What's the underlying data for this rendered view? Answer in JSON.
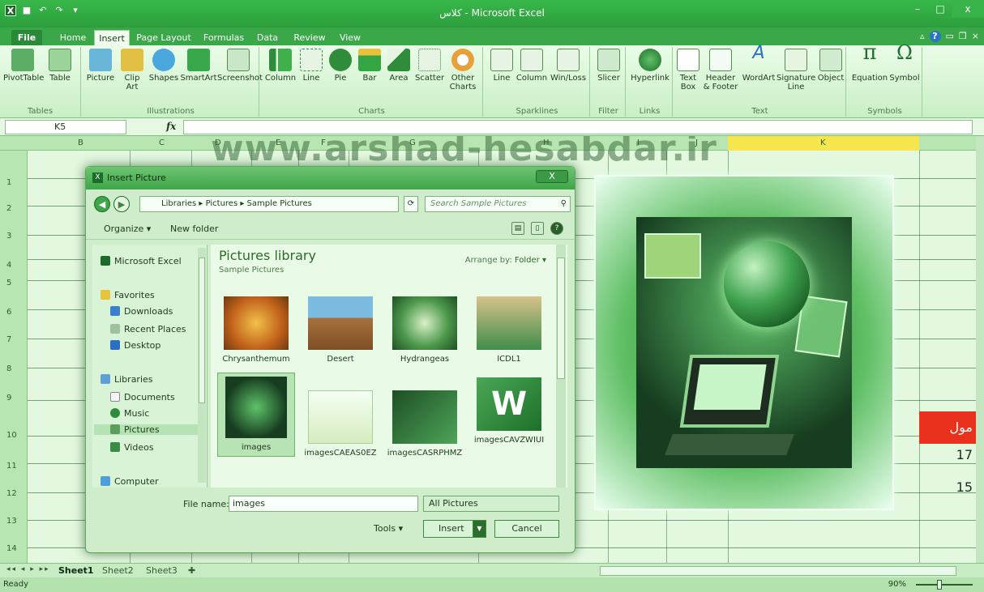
{
  "window": {
    "title": "كلاس - Microsoft Excel"
  },
  "tabs": [
    "File",
    "Home",
    "Insert",
    "Page Layout",
    "Formulas",
    "Data",
    "Review",
    "View"
  ],
  "ribbon": {
    "tables": {
      "label": "Tables",
      "items": [
        "PivotTable",
        "Table"
      ]
    },
    "illustrations": {
      "label": "Illustrations",
      "items": [
        "Picture",
        "Clip Art",
        "Shapes",
        "SmartArt",
        "Screenshot"
      ]
    },
    "charts": {
      "label": "Charts",
      "items": [
        "Column",
        "Line",
        "Pie",
        "Bar",
        "Area",
        "Scatter",
        "Other Charts"
      ]
    },
    "sparklines": {
      "label": "Sparklines",
      "items": [
        "Line",
        "Column",
        "Win/Loss"
      ]
    },
    "filter": {
      "label": "Filter",
      "items": [
        "Slicer"
      ]
    },
    "links": {
      "label": "Links",
      "items": [
        "Hyperlink"
      ]
    },
    "text": {
      "label": "Text",
      "items": [
        "Text Box",
        "Header & Footer",
        "WordArt",
        "Signature Line",
        "Object"
      ]
    },
    "symbols": {
      "label": "Symbols",
      "items": [
        "Equation",
        "Symbol"
      ]
    }
  },
  "formula_bar": {
    "name_box": "K5",
    "fx": "fx",
    "value": ""
  },
  "watermark": "www.arshad-hesabdar.ir",
  "columns": [
    "B",
    "C",
    "D",
    "E",
    "F",
    "G",
    "H",
    "I",
    "J",
    "K"
  ],
  "rows": [
    "1",
    "2",
    "3",
    "4",
    "5",
    "6",
    "7",
    "8",
    "9",
    "10",
    "11",
    "12",
    "13",
    "14"
  ],
  "cells": {
    "k10": "مول",
    "k11": "17",
    "k12": "15"
  },
  "dialog": {
    "title": "Insert Picture",
    "close": "X",
    "address": "Libraries ▸ Pictures ▸ Sample Pictures",
    "search_placeholder": "Search Sample Pictures",
    "organize": "Organize ▾",
    "new_folder": "New folder",
    "nav": [
      "Microsoft Excel",
      "Favorites",
      "Downloads",
      "Recent Places",
      "Desktop",
      "Libraries",
      "Documents",
      "Music",
      "Pictures",
      "Videos",
      "Computer"
    ],
    "library_title": "Pictures library",
    "library_sub": "Sample Pictures",
    "arrange_label": "Arrange by:",
    "arrange_value": "Folder ▾",
    "thumbs": [
      "Chrysanthemum",
      "Desert",
      "Hydrangeas",
      "ICDL1",
      "images",
      "imagesCAEAS0EZ",
      "imagesCASRPHMZ",
      "imagesCAVZWIUI"
    ],
    "file_name_label": "File name:",
    "file_name_value": "images",
    "filter_value": "All Pictures",
    "tools": "Tools ▾",
    "insert": "Insert",
    "cancel": "Cancel"
  },
  "sheets": [
    "Sheet1",
    "Sheet2",
    "Sheet3"
  ],
  "status": {
    "ready": "Ready",
    "zoom": "90%"
  }
}
